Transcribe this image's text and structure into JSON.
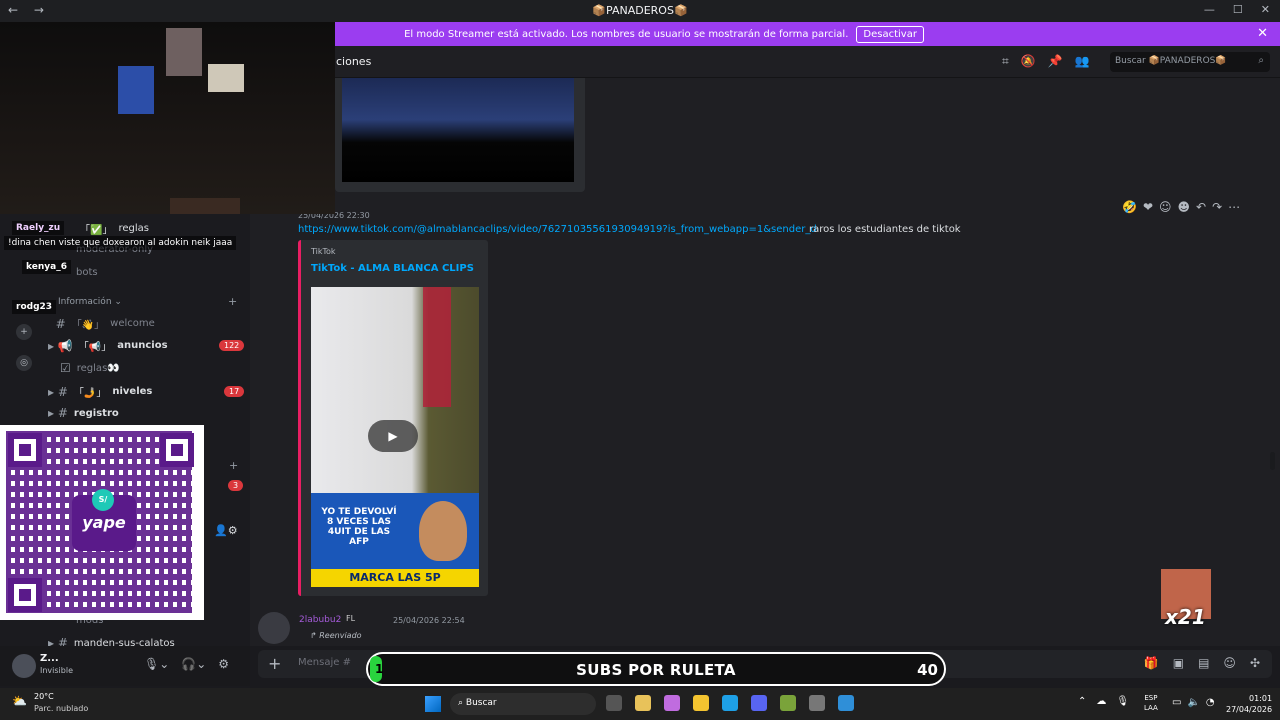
{
  "window": {
    "title": "📦PANADEROS📦",
    "nav": "← →",
    "controls": [
      "—",
      "☐",
      "✕"
    ]
  },
  "banner": {
    "text": "El modo Streamer está activado. Los nombres de usuario se mostrarán de forma parcial.",
    "button": "Desactivar",
    "close": "✕"
  },
  "header": {
    "channel": "ciones",
    "search_placeholder": "Buscar 📦PANADEROS📦"
  },
  "message1": {
    "meta": "25/04/2026 22:30",
    "link": "https://www.tiktok.com/@almablancaclips/video/7627103556193094919?is_from_webapp=1&sender_device=pc",
    "text": "raros los estudiantes de tiktok",
    "embed_provider": "TikTok",
    "embed_title": "TikTok - ALMA BLANCA CLIPS",
    "ad_line1": "YO TE DEVOLVÍ 8 VECES LAS 4UIT DE LAS AFP",
    "ad_line2": "MARCA LAS 5P"
  },
  "message2": {
    "user": "2labubu2",
    "badges": "FL",
    "time": "25/04/2026 22:54",
    "forwarded": "Reenviado"
  },
  "composer": {
    "placeholder": "Mensaje #",
    "placeholder2": "reacciones"
  },
  "sidebar": {
    "category": "Información",
    "channels": [
      {
        "label": "reglas",
        "prefix": "「✅」"
      },
      {
        "label": "moderator-only"
      },
      {
        "label": "bots"
      },
      {
        "label": "welcome",
        "prefix": "「👋」"
      },
      {
        "label": "anuncios",
        "prefix": "「📢」",
        "badge": "122"
      },
      {
        "label": "reglas👀"
      },
      {
        "label": "niveles",
        "prefix": "「🤳」",
        "badge": "17"
      },
      {
        "label": "registro"
      },
      {
        "label": "mods"
      },
      {
        "label": "manden-sus-calatos"
      }
    ],
    "badge_extra": "3"
  },
  "overlay_chat": [
    {
      "user": "Raely_zu"
    },
    {
      "text": "!dina chen viste que doxearon al adokin neik jaaa"
    },
    {
      "user": "kenya_6"
    },
    {
      "user": "rodg23"
    }
  ],
  "user_panel": {
    "name": "Z...",
    "status": "Invisible"
  },
  "subs": {
    "current": "1",
    "label": "SUBS POR RULETA",
    "goal": "40"
  },
  "emote": {
    "count": "x21"
  },
  "qr": {
    "brand": "yape",
    "symbol": "S/"
  },
  "taskbar": {
    "temp": "20°C",
    "condition": "Parc. nublado",
    "search": "Buscar",
    "lang1": "ESP",
    "lang2": "LAA",
    "time": "01:01",
    "date": "27/04/2026"
  }
}
